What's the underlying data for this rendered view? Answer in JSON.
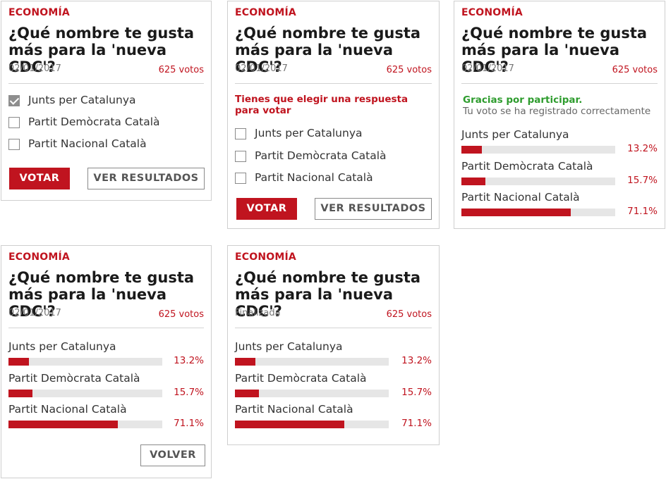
{
  "section": "ECONOMÍA",
  "question": "¿Qué nombre te gusta más para la 'nueva CDC'?",
  "date": "02/01/2017",
  "finished_label": "Finalizada",
  "votes": "625 votos",
  "options": [
    "Junts per Catalunya",
    "Partit Demòcrata Català",
    "Partit Nacional Català"
  ],
  "results": [
    {
      "label": "Junts per Catalunya",
      "pct_text": "13.2%",
      "pct": 13.2
    },
    {
      "label": "Partit Demòcrata Català",
      "pct_text": "15.7%",
      "pct": 15.7
    },
    {
      "label": "Partit Nacional Català",
      "pct_text": "71.1%",
      "pct": 71.1
    }
  ],
  "buttons": {
    "vote": "VOTAR",
    "results": "VER RESULTADOS",
    "back": "VOLVER"
  },
  "error_msg": "Tienes que elegir una respuesta para votar",
  "thanks_title": "Gracias por participar.",
  "thanks_sub": "Tu voto se ha registrado correctamente",
  "card1_checked_index": 0,
  "colors": {
    "accent": "#c0141f",
    "success": "#2e9c2e",
    "bar_bg": "#e6e6e6"
  }
}
